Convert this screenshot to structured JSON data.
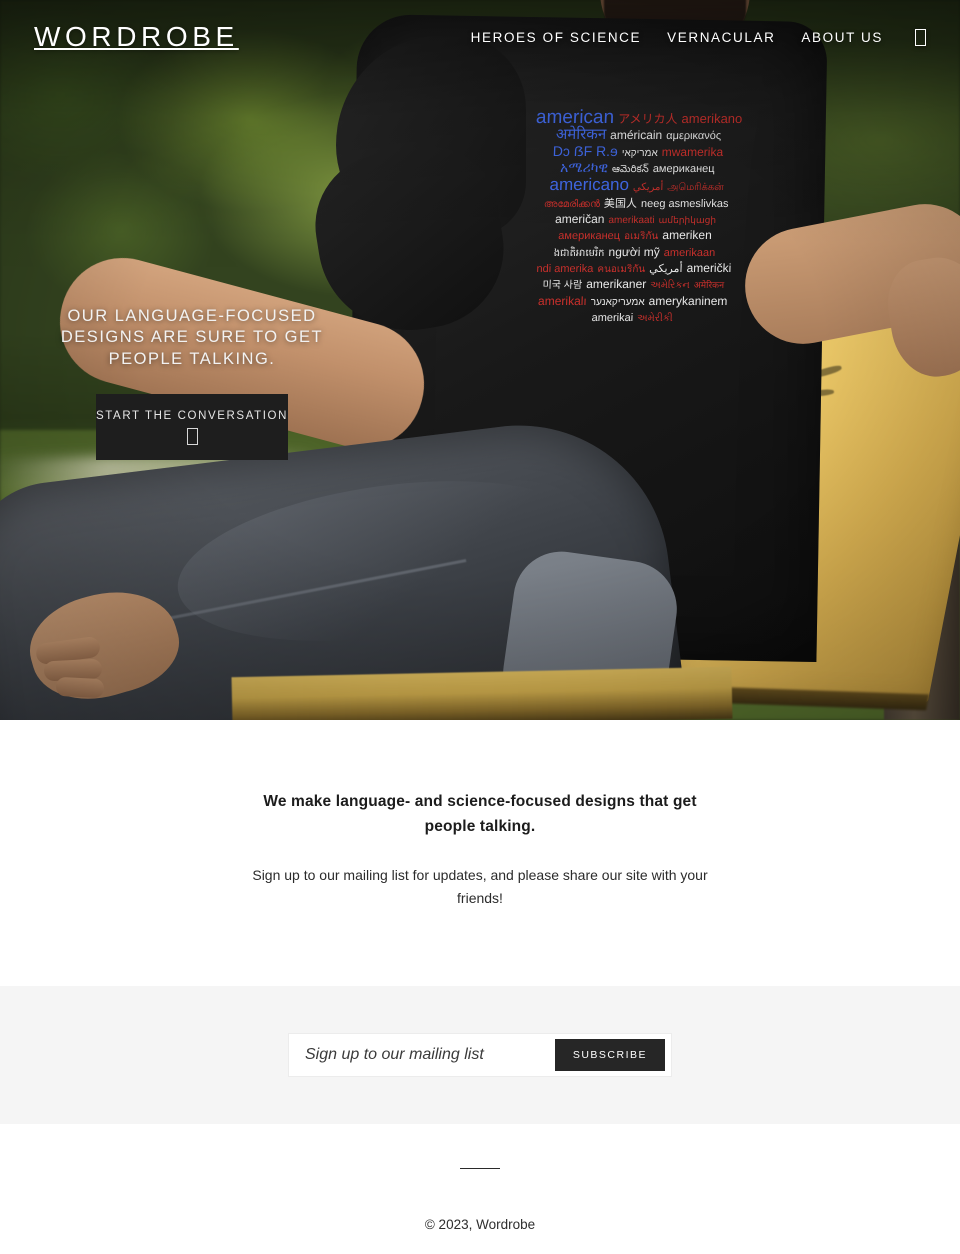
{
  "site": {
    "logo": "WORDROBE"
  },
  "nav": {
    "items": [
      {
        "label": "HEROES OF SCIENCE"
      },
      {
        "label": "VERNACULAR"
      },
      {
        "label": "ABOUT US"
      }
    ],
    "cart_icon": "cart-icon-missing-glyph"
  },
  "hero": {
    "headline": "OUR LANGUAGE-FOCUSED DESIGNS ARE SURE TO GET PEOPLE TALKING.",
    "cta_label": "START THE CONVERSATION",
    "cta_icon": "arrow-icon-missing-glyph",
    "tshirt_design": {
      "theme": "american",
      "lines": [
        {
          "words": [
            {
              "text": "american",
              "color": "blue",
              "size": 19
            },
            {
              "text": "アメリカ人",
              "color": "red",
              "size": 12
            },
            {
              "text": "amerikano",
              "color": "red",
              "size": 13
            }
          ]
        },
        {
          "words": [
            {
              "text": "अमेरिकन",
              "color": "blue",
              "size": 15
            },
            {
              "text": "américain",
              "color": "white",
              "size": 12
            },
            {
              "text": "αμερικανός",
              "color": "white",
              "size": 11
            }
          ]
        },
        {
          "words": [
            {
              "text": "Dɔ ẞF R.ɘ",
              "color": "blue",
              "size": 14
            },
            {
              "text": "אמריקאי",
              "color": "white",
              "size": 10
            },
            {
              "text": "mwamerika",
              "color": "red",
              "size": 12
            }
          ]
        },
        {
          "words": [
            {
              "text": "አሜሪካዊ",
              "color": "blue",
              "size": 14
            },
            {
              "text": "ఆమెరికన్",
              "color": "white",
              "size": 10
            },
            {
              "text": "американец",
              "color": "white",
              "size": 11
            }
          ]
        },
        {
          "words": [
            {
              "text": "americano",
              "color": "blue",
              "size": 17
            },
            {
              "text": "أمريكي",
              "color": "red",
              "size": 10
            },
            {
              "text": "அமெரிக்கன்",
              "color": "red",
              "size": 10
            }
          ]
        },
        {
          "words": [
            {
              "text": "അമേരിക്കൻ",
              "color": "red",
              "size": 10
            },
            {
              "text": "美国人",
              "color": "white",
              "size": 11
            },
            {
              "text": "neeg asmeslivkas",
              "color": "white",
              "size": 11
            }
          ]
        },
        {
          "words": [
            {
              "text": "američan",
              "color": "white",
              "size": 12
            },
            {
              "text": "amerikaati",
              "color": "red",
              "size": 10
            },
            {
              "text": "ամերիկացի",
              "color": "red",
              "size": 9
            }
          ]
        },
        {
          "words": [
            {
              "text": "американец",
              "color": "red",
              "size": 11
            },
            {
              "text": "อเมริกัน",
              "color": "red",
              "size": 10
            },
            {
              "text": "ameriken",
              "color": "white",
              "size": 12
            }
          ]
        },
        {
          "words": [
            {
              "text": "ងជាតិអាមេរិក",
              "color": "white",
              "size": 10
            },
            {
              "text": "người mỹ",
              "color": "white",
              "size": 12
            },
            {
              "text": "amerikaan",
              "color": "red",
              "size": 11
            }
          ]
        },
        {
          "words": [
            {
              "text": "ndi amerika",
              "color": "red",
              "size": 11
            },
            {
              "text": "คนอเมริกัน",
              "color": "red",
              "size": 10
            },
            {
              "text": "أمريكي",
              "color": "white",
              "size": 11
            },
            {
              "text": "američki",
              "color": "white",
              "size": 12
            }
          ]
        },
        {
          "words": [
            {
              "text": "미국 사람",
              "color": "white",
              "size": 10
            },
            {
              "text": "amerikaner",
              "color": "white",
              "size": 12
            },
            {
              "text": "અમેરિકન",
              "color": "red",
              "size": 10
            },
            {
              "text": "अमेरिकन",
              "color": "red",
              "size": 9
            }
          ]
        },
        {
          "words": [
            {
              "text": "amerikalı",
              "color": "red",
              "size": 12
            },
            {
              "text": "אמעריקאנער",
              "color": "white",
              "size": 10
            },
            {
              "text": "amerykaninem",
              "color": "white",
              "size": 12
            }
          ]
        },
        {
          "words": [
            {
              "text": "amerikai",
              "color": "white",
              "size": 11
            },
            {
              "text": "અમેરીકી",
              "color": "red",
              "size": 10
            }
          ]
        }
      ]
    }
  },
  "intro": {
    "heading": "We make language- and science-focused designs that get people talking.",
    "subtext": "Sign up to our mailing list for updates, and please share our site with your friends!"
  },
  "subscribe": {
    "placeholder": "Sign up to our mailing list",
    "value": "",
    "button_label": "SUBSCRIBE"
  },
  "footer": {
    "copyright": "© 2023, Wordrobe"
  },
  "colors": {
    "page_background": "#ffffff",
    "subscribe_band": "#f5f5f5",
    "dark_button": "#1e1e1e",
    "text_primary": "#1c1c1c",
    "shirt_blue": "#4169e8",
    "shirt_red": "#c9302c",
    "shirt_white": "#e8e8e8"
  }
}
